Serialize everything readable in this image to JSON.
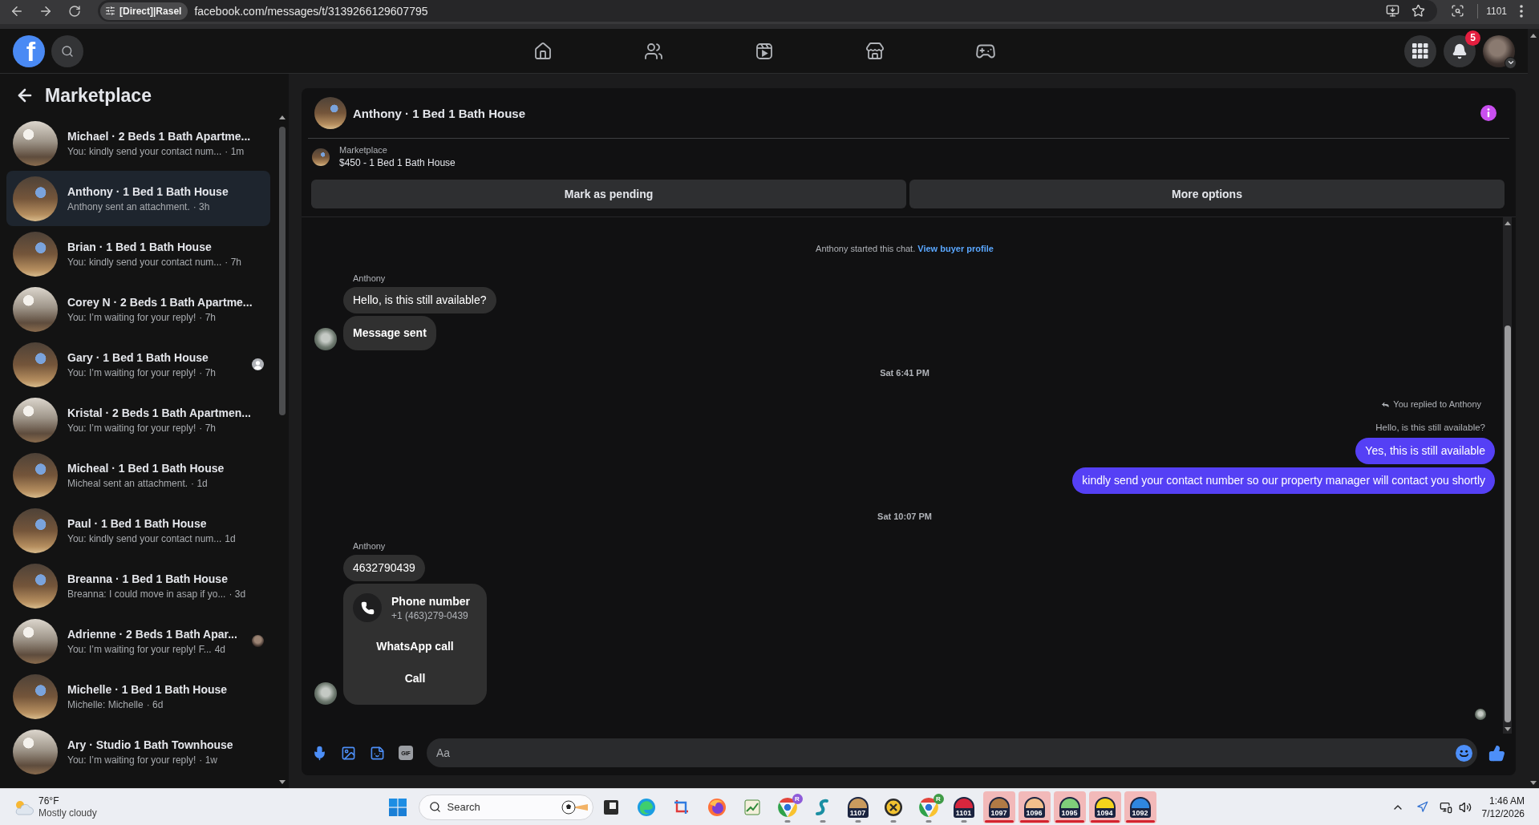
{
  "browser": {
    "site_chip": "[Direct]|Rasel",
    "url": "facebook.com/messages/t/3139266129607795",
    "profile_label": "1101"
  },
  "header": {
    "logo": "f",
    "notification_count": "5"
  },
  "sidebar": {
    "title": "Marketplace",
    "conversations": [
      {
        "kind": "light",
        "title": "Michael · 2 Beds 1 Bath Apartme...",
        "preview": "You: kindly send your contact num...",
        "time": "· 1m",
        "selected": false
      },
      {
        "kind": "wood",
        "title": "Anthony · 1 Bed 1 Bath House",
        "preview": "Anthony sent an attachment.",
        "time": "· 3h",
        "selected": true
      },
      {
        "kind": "wood",
        "title": "Brian · 1 Bed 1 Bath House",
        "preview": "You: kindly send your contact num...",
        "time": "· 7h",
        "selected": false
      },
      {
        "kind": "light",
        "title": "Corey N · 2 Beds 1 Bath Apartme...",
        "preview": "You: I’m waiting for your reply!",
        "time": "· 7h",
        "selected": false
      },
      {
        "kind": "wood",
        "title": "Gary · 1 Bed 1 Bath House",
        "preview": "You: I’m waiting for your reply!",
        "time": "· 7h",
        "selected": false,
        "seen": {
          "kind": "silhouette"
        }
      },
      {
        "kind": "light",
        "title": "Kristal · 2 Beds 1 Bath Apartmen...",
        "preview": "You: I’m waiting for your reply!",
        "time": "· 7h",
        "selected": false
      },
      {
        "kind": "wood",
        "title": "Micheal · 1 Bed 1 Bath House",
        "preview": "Micheal sent an attachment.",
        "time": "· 1d",
        "selected": false
      },
      {
        "kind": "wood",
        "title": "Paul · 1 Bed 1 Bath House",
        "preview": "You: kindly send your contact num...",
        "time": "1d",
        "selected": false
      },
      {
        "kind": "wood",
        "title": "Breanna · 1 Bed 1 Bath House",
        "preview": "Breanna: I could move in asap if yo...",
        "time": "· 3d",
        "selected": false
      },
      {
        "kind": "light",
        "title": "Adrienne · 2 Beds 1 Bath Apar...",
        "preview": "You: I’m waiting for your reply! F...",
        "time": "4d",
        "selected": false,
        "seen": {
          "kind": "photo"
        }
      },
      {
        "kind": "wood",
        "title": "Michelle · 1 Bed 1 Bath House",
        "preview": "Michelle: Michelle",
        "time": "· 6d",
        "selected": false
      },
      {
        "kind": "light",
        "title": "Ary · Studio 1 Bath Townhouse",
        "preview": "You: I’m waiting for your reply!",
        "time": "· 1w",
        "selected": false
      }
    ]
  },
  "chat": {
    "title": "Anthony · 1 Bed 1 Bath House",
    "listing": {
      "source": "Marketplace",
      "title": "$450 - 1 Bed 1 Bath House"
    },
    "actions": [
      "Mark as pending",
      "More options"
    ],
    "thread": [
      {
        "kind": "system",
        "text": "Anthony started this chat.",
        "link": "View buyer profile"
      },
      {
        "kind": "incoming",
        "sender": "Anthony",
        "messages": [
          {
            "kind": "text",
            "text": "Hello, is this still available?"
          },
          {
            "kind": "status",
            "text": "Message sent"
          }
        ]
      },
      {
        "kind": "time",
        "text": "Sat 6:41 PM"
      },
      {
        "kind": "outgoing",
        "reply_note": "You replied to Anthony",
        "quote": "Hello, is this still available?",
        "messages": [
          {
            "kind": "text",
            "text": "Yes, this is still available"
          },
          {
            "kind": "text",
            "text": "kindly send your contact number so our property manager will contact you shortly"
          }
        ]
      },
      {
        "kind": "time",
        "text": "Sat 10:07 PM"
      },
      {
        "kind": "incoming",
        "sender": "Anthony",
        "messages": [
          {
            "kind": "text",
            "text": "4632790439"
          },
          {
            "kind": "contact",
            "title": "Phone number",
            "detail": "+1 (463)279-0439",
            "actions": [
              "WhatsApp call",
              "Call"
            ]
          }
        ]
      }
    ],
    "composer": {
      "gif_label": "GIF",
      "placeholder": "Aa"
    }
  },
  "taskbar": {
    "weather": {
      "temperature": "76°F",
      "condition": "Mostly cloudy"
    },
    "search": {
      "placeholder": "Search"
    },
    "apps": [
      {
        "kind": "square",
        "running": false
      },
      {
        "kind": "edge",
        "running": false
      },
      {
        "kind": "crop",
        "running": false
      },
      {
        "kind": "firefox",
        "running": false
      },
      {
        "kind": "chart",
        "running": false
      },
      {
        "kind": "chrome",
        "badge": "R",
        "color": "#8e5bd9",
        "running": true
      },
      {
        "kind": "curve",
        "running": true
      },
      {
        "kind": "profile",
        "label": "1107",
        "color": "#c99a5e",
        "running": true,
        "flashing": false
      },
      {
        "kind": "xcircle",
        "running": true
      },
      {
        "kind": "chrome",
        "badge": "R",
        "color": "#3f9b46",
        "running": true
      },
      {
        "kind": "profile",
        "label": "1101",
        "color": "#d7263d",
        "running": true,
        "flashing": false
      },
      {
        "kind": "profile",
        "label": "1097",
        "color": "#b07a45",
        "running": true,
        "flashing": true
      },
      {
        "kind": "profile",
        "label": "1096",
        "color": "#f2bf8c",
        "running": true,
        "flashing": true
      },
      {
        "kind": "profile",
        "label": "1095",
        "color": "#7fcf7a",
        "running": true,
        "flashing": true
      },
      {
        "kind": "profile",
        "label": "1094",
        "color": "#f3d31c",
        "running": true,
        "flashing": true
      },
      {
        "kind": "profile",
        "label": "1092",
        "color": "#2f86e0",
        "running": true,
        "flashing": true
      }
    ],
    "clock": {
      "time": "1:46 AM",
      "date": "7/12/2026"
    }
  }
}
